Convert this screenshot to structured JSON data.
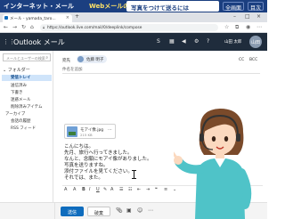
{
  "banner": {
    "title": "インターネット・メール",
    "subtitle": "Webメールの活用",
    "lesson": "写真をつけて送るには",
    "btn_full": "全画面",
    "btn_back": "目次"
  },
  "browser": {
    "tab_title": "メール - yamada_taro...",
    "tab_close": "×",
    "url": "https://outlook.live.com/mail/0/deeplink/compose",
    "minimize": "–",
    "maximize": "□",
    "close": "×"
  },
  "outlook": {
    "app_name": "Outlook メール",
    "user_name": "山田 太郎",
    "avatar_initials": "山田"
  },
  "sidebar": {
    "search_placeholder": "メールとユーザーの検索",
    "folders_label": "フォルダー",
    "items": [
      {
        "label": "受信トレイ",
        "selected": true
      },
      {
        "label": "送信済み"
      },
      {
        "label": "下書き"
      },
      {
        "label": "迷惑メール"
      },
      {
        "label": "削除済みアイテム"
      },
      {
        "label": "アーカイブ"
      },
      {
        "label": "会話の履歴"
      },
      {
        "label": "RSS フィード"
      }
    ]
  },
  "compose": {
    "to_label": "宛先",
    "recipient": "佐藤 明子",
    "cc": "CC",
    "bcc": "BCC",
    "subject_placeholder": "件名を追加",
    "attachment": {
      "name": "モアイ像.jpg",
      "size": "215 KB",
      "more": "⋯"
    },
    "body_lines": [
      "こんにちは。",
      "先月、旅行へ行ってきました。",
      "なんと、念願にモアイ像がありました。",
      "写真を送りますね。",
      "添付ファイルを見てください。",
      "それでは、また。"
    ]
  },
  "actions": {
    "send": "送信",
    "discard": "破棄"
  },
  "colors": {
    "banner": "#1b3f80",
    "outlook_header": "#1f2c3c",
    "accent": "#0f6cbd",
    "selection": "#cfe4fa"
  }
}
